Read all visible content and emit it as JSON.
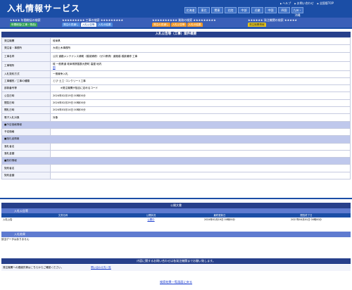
{
  "app": {
    "title": "入札情報サービス"
  },
  "top_links": [
    "ヘルプ",
    "お問い合わせ",
    "全国版TOP"
  ],
  "regions": [
    "北海道",
    "東北",
    "関東",
    "北陸",
    "中部",
    "近畿",
    "中国",
    "四国",
    "九州・沖縄"
  ],
  "nav": {
    "groups": [
      {
        "title": "★★★★ 年間総括の検索",
        "tabs": [
          {
            "label": "年間総括(工事・物品)",
            "style": "green"
          }
        ]
      },
      {
        "title": "★★★★★★★★★ 工事の検索 ★★★★★★★★★",
        "tabs": [
          {
            "label": "発注の見通し",
            "style": "blue"
          },
          {
            "label": "入札公告等",
            "style": "active"
          },
          {
            "label": "入札の結果",
            "style": "blue"
          }
        ]
      },
      {
        "title": "★★★★★★★★★★ 業務の検索 ★★★★★★★★★",
        "tabs": [
          {
            "label": "発注の見通し",
            "style": "orange"
          },
          {
            "label": "入札公告等",
            "style": "orange"
          },
          {
            "label": "入札の結果",
            "style": "orange"
          }
        ]
      },
      {
        "title": "★★★★★★ 発注機関の検索 ★★★★★",
        "tabs": [
          {
            "label": "発注機関情報",
            "style": "yellow"
          }
        ]
      }
    ]
  },
  "main": {
    "header": "入札公告等（工事）案件概要",
    "rows": [
      {
        "label": "発注機関",
        "value": "岐阜県"
      },
      {
        "label": "発注者・事務所",
        "value": "大垣土木事務所"
      },
      {
        "label": "工事名称",
        "value": "公共 道路メンテナンス補助（橋梁補修）（ゼロ県債）道路橋 橋梁補修 工事"
      },
      {
        "label": "工事場所",
        "value": "岐 一般県道 岐阜県揖斐郡大野町 高屋 地内",
        "value2": "図",
        "tall": true
      },
      {
        "label": "入札契約方式",
        "value": "一般競争入札"
      },
      {
        "label": "工事種別／工事の種類",
        "value": "とび･土工･コンクリート工事"
      },
      {
        "label": "部款番号等",
        "value": "　　　※発注機関が独自に定めるコード"
      },
      {
        "label": "公告日時",
        "value": "2024年02月19日 00時00分"
      },
      {
        "label": "閲覧日時",
        "value": "2024年02月29日 00時00分"
      },
      {
        "label": "開札日時",
        "value": "2024年03月14日 00時00分"
      },
      {
        "label": "電子入札対象",
        "value": "対象"
      },
      {
        "label": "■予定価格情報",
        "section": true
      },
      {
        "label": "予定価格",
        "value": ""
      },
      {
        "label": "■落札者情報",
        "section": true
      },
      {
        "label": "落札者名",
        "value": ""
      },
      {
        "label": "落札金額",
        "value": ""
      },
      {
        "label": "■契約情報",
        "section": true
      },
      {
        "label": "契約者名",
        "value": ""
      },
      {
        "label": "契約金額",
        "value": ""
      }
    ]
  },
  "documents": {
    "header": "公開文書",
    "notice_section": "入札公告等",
    "columns": [
      "文書名称",
      "公開状況",
      "最終更新日",
      "閲覧終了日"
    ],
    "rows": [
      {
        "name": "入札公告",
        "status": "公開中",
        "updated": "2024年02月19日 00時00分",
        "end": "2027年04月01日 00時00分"
      }
    ],
    "result_section": "入札結果",
    "no_data": "該当データはありません"
  },
  "contact": {
    "header": "内容に関するお問い合わせは各発注機関までお願い致します。",
    "text": "発注機関への連絡先等はこちらからご確認ください。",
    "link": "問い合わせ先一覧"
  },
  "back_link": "検索結果一覧画面に戻る",
  "colors": {
    "brand": "#1b4ea6",
    "header": "#27408b",
    "section_bg": "#bfc8ec",
    "link": "#1a3ccf"
  }
}
